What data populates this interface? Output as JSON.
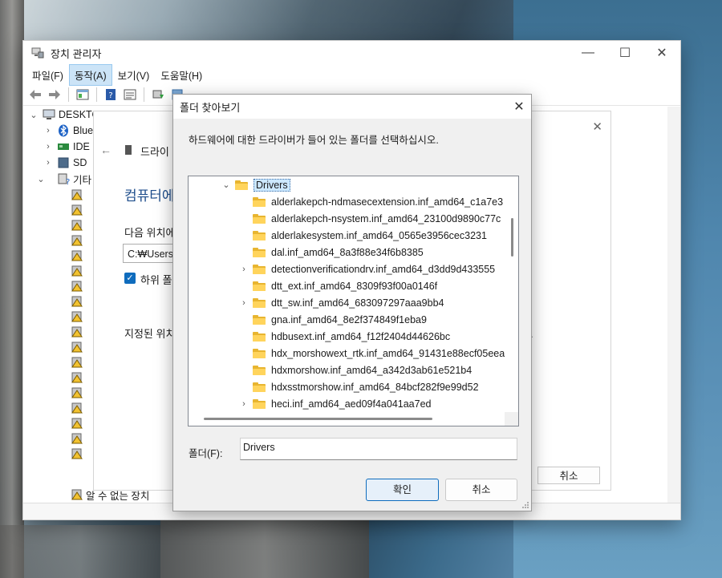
{
  "device_manager": {
    "title": "장치 관리자",
    "menu": [
      "파일(F)",
      "동작(A)",
      "보기(V)",
      "도움말(H)"
    ],
    "active_menu_index": 1,
    "tree": {
      "root": "DESKTO",
      "items": [
        {
          "label": "Blue",
          "icon": "bluetooth-icon"
        },
        {
          "label": "IDE",
          "icon": "ide-controller-icon"
        },
        {
          "label": "SD",
          "icon": "sd-host-icon"
        },
        {
          "label": "기타",
          "icon": "other-devices-icon"
        }
      ],
      "last_item_label": "알 수 없는 장치"
    }
  },
  "wizard": {
    "device_name": "드라이",
    "heading": "컴퓨터에",
    "location_label": "다음 위치에",
    "path_value": "C:₩Users₩",
    "include_subfolders_label": "하위 폴",
    "description_start": "지정된 위치",
    "description_end": "다.",
    "cancel_label": "취소"
  },
  "dialog": {
    "title": "폴더 찾아보기",
    "prompt": "하드웨어에 대한 드라이버가 들어 있는 폴더를 선택하십시오.",
    "root_folder": "Drivers",
    "folders": [
      {
        "name": "alderlakepch-ndmasecextension.inf_amd64_c1a7e3",
        "expandable": false
      },
      {
        "name": "alderlakepch-nsystem.inf_amd64_23100d9890c77c",
        "expandable": false
      },
      {
        "name": "alderlakesystem.inf_amd64_0565e3956cec3231",
        "expandable": false
      },
      {
        "name": "dal.inf_amd64_8a3f88e34f6b8385",
        "expandable": false
      },
      {
        "name": "detectionverificationdrv.inf_amd64_d3dd9d433555",
        "expandable": true
      },
      {
        "name": "dtt_ext.inf_amd64_8309f93f00a0146f",
        "expandable": false
      },
      {
        "name": "dtt_sw.inf_amd64_683097297aaa9bb4",
        "expandable": true
      },
      {
        "name": "gna.inf_amd64_8e2f374849f1eba9",
        "expandable": false
      },
      {
        "name": "hdbusext.inf_amd64_f12f2404d44626bc",
        "expandable": false
      },
      {
        "name": "hdx_morshowext_rtk.inf_amd64_91431e88ecf05eea",
        "expandable": false
      },
      {
        "name": "hdxmorshow.inf_amd64_a342d3ab61e521b4",
        "expandable": false
      },
      {
        "name": "hdxsstmorshow.inf_amd64_84bcf282f9e99d52",
        "expandable": false
      },
      {
        "name": "heci.inf_amd64_aed09f4a041aa7ed",
        "expandable": true
      }
    ],
    "folder_field_label": "폴더(F):",
    "folder_field_value": "Drivers",
    "ok_label": "확인",
    "cancel_label": "취소"
  },
  "colors": {
    "accent": "#0f6cbd",
    "folder_yellow": "#ffd45c",
    "selection": "#cce8ff"
  }
}
